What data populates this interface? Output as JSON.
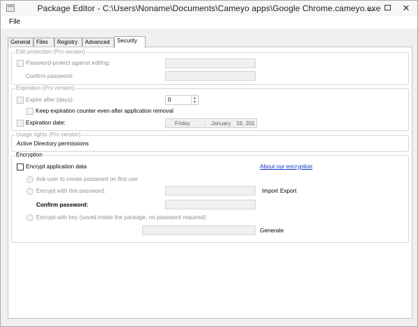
{
  "window": {
    "title": "Package Editor - C:\\Users\\Noname\\Documents\\Cameyo apps\\Google Chrome.cameyo.exe"
  },
  "menu": {
    "file": "File"
  },
  "tabs": [
    {
      "label": "General",
      "active": false
    },
    {
      "label": "Files",
      "active": false
    },
    {
      "label": "Registry",
      "active": false
    },
    {
      "label": "Advanced",
      "active": false
    },
    {
      "label": "Security",
      "active": true
    }
  ],
  "edit_protection": {
    "group_label": "Edit protection (Pro version)",
    "password_protect_label": "Password-protect against editing:",
    "confirm_password_label": "Confirm password:",
    "password_protect_checked": false
  },
  "expiration": {
    "group_label": "Expiration (Pro version)",
    "expire_after_label": "Expire after (days):",
    "expire_after_value": "0",
    "keep_counter_label": "Keep expiration counter even after application removal",
    "expiration_date_label": "Expiration date:",
    "date_weekday": "Friday",
    "date_separator": ",",
    "date_month": "January",
    "date_day_year": "16, 201"
  },
  "usage_rights": {
    "group_label": "Usage rights (Pro version)",
    "active_directory_label": "Active Directory permissions"
  },
  "encryption": {
    "group_label": "Encryption",
    "encrypt_app_label": "Encrypt application data",
    "encrypt_app_checked": false,
    "about_link": "About our encryption",
    "ask_user_label": "Ask user to create password on first use",
    "encrypt_password_label": "Encrypt with this password:",
    "import_label": "Import",
    "export_label": "Export",
    "confirm_password_label": "Confirm password:",
    "encrypt_key_label": "Encrypt with key (saved inside the package, no password required):",
    "generate_label": "Generate"
  },
  "colors": {
    "link": "#0b35c9",
    "disabled_text": "#8e8e8e"
  },
  "icons": {
    "minimize": "minimize-icon",
    "maximize": "maximize-icon",
    "close": "close-icon",
    "app": "app-icon",
    "close_glyph": "✕"
  }
}
